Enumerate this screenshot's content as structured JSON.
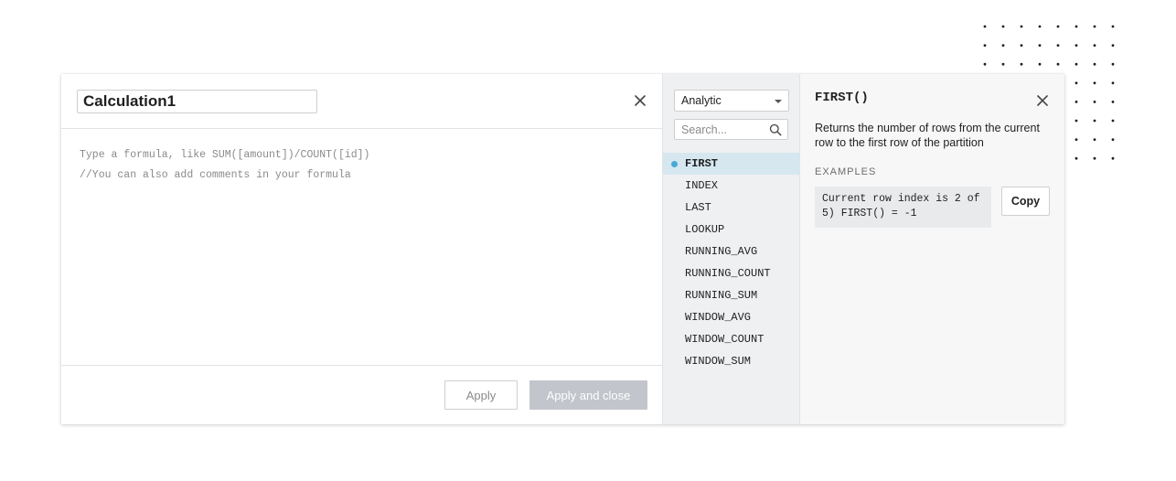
{
  "editor": {
    "calculation_name": "Calculation1",
    "formula_lines": [
      "Type a formula, like SUM([amount])/COUNT([id])",
      "//You can also add comments in your formula"
    ],
    "apply_label": "Apply",
    "apply_close_label": "Apply and close"
  },
  "function_panel": {
    "category_selected": "Analytic",
    "search_placeholder": "Search...",
    "functions": [
      "FIRST",
      "INDEX",
      "LAST",
      "LOOKUP",
      "RUNNING_AVG",
      "RUNNING_COUNT",
      "RUNNING_SUM",
      "WINDOW_AVG",
      "WINDOW_COUNT",
      "WINDOW_SUM"
    ],
    "selected_function": "FIRST"
  },
  "docs": {
    "title": "FIRST()",
    "description": "Returns the number of rows from the current row to the first row of the partition",
    "examples_label": "EXAMPLES",
    "example_text": "Current row index is 2 of 5) FIRST() = -1",
    "copy_label": "Copy"
  },
  "colors": {
    "accent_dot": "#4aa9d4",
    "selected_row": "#d6e7f0",
    "primary_button_disabled": "#c2c5cc",
    "function_pane_bg": "#eff0f2"
  },
  "icons": {
    "editor_close": "close-icon",
    "docs_close": "close-icon",
    "search": "search-icon",
    "dropdown": "chevron-down-icon",
    "pointer": "cursor-icon"
  }
}
